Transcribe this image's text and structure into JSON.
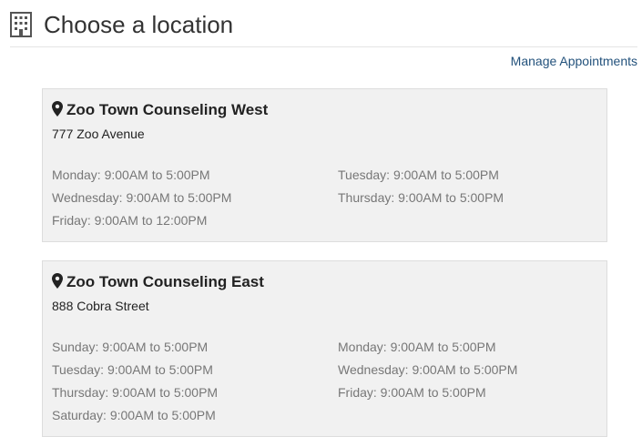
{
  "header": {
    "title": "Choose a location",
    "icon": "building-icon"
  },
  "manage_link": "Manage Appointments",
  "colors": {
    "link": "#23527c",
    "card_bg": "#f1f1f1",
    "muted_text": "#777777"
  },
  "locations": [
    {
      "name": "Zoo Town Counseling West",
      "address": "777 Zoo Avenue",
      "hours": [
        "Monday: 9:00AM to 5:00PM",
        "Tuesday: 9:00AM to 5:00PM",
        "Wednesday: 9:00AM to 5:00PM",
        "Thursday: 9:00AM to 5:00PM",
        "Friday: 9:00AM to 12:00PM"
      ]
    },
    {
      "name": "Zoo Town Counseling East",
      "address": "888 Cobra Street",
      "hours": [
        "Sunday: 9:00AM to 5:00PM",
        "Monday: 9:00AM to 5:00PM",
        "Tuesday: 9:00AM to 5:00PM",
        "Wednesday: 9:00AM to 5:00PM",
        "Thursday: 9:00AM to 5:00PM",
        "Friday: 9:00AM to 5:00PM",
        "Saturday: 9:00AM to 5:00PM"
      ]
    }
  ]
}
